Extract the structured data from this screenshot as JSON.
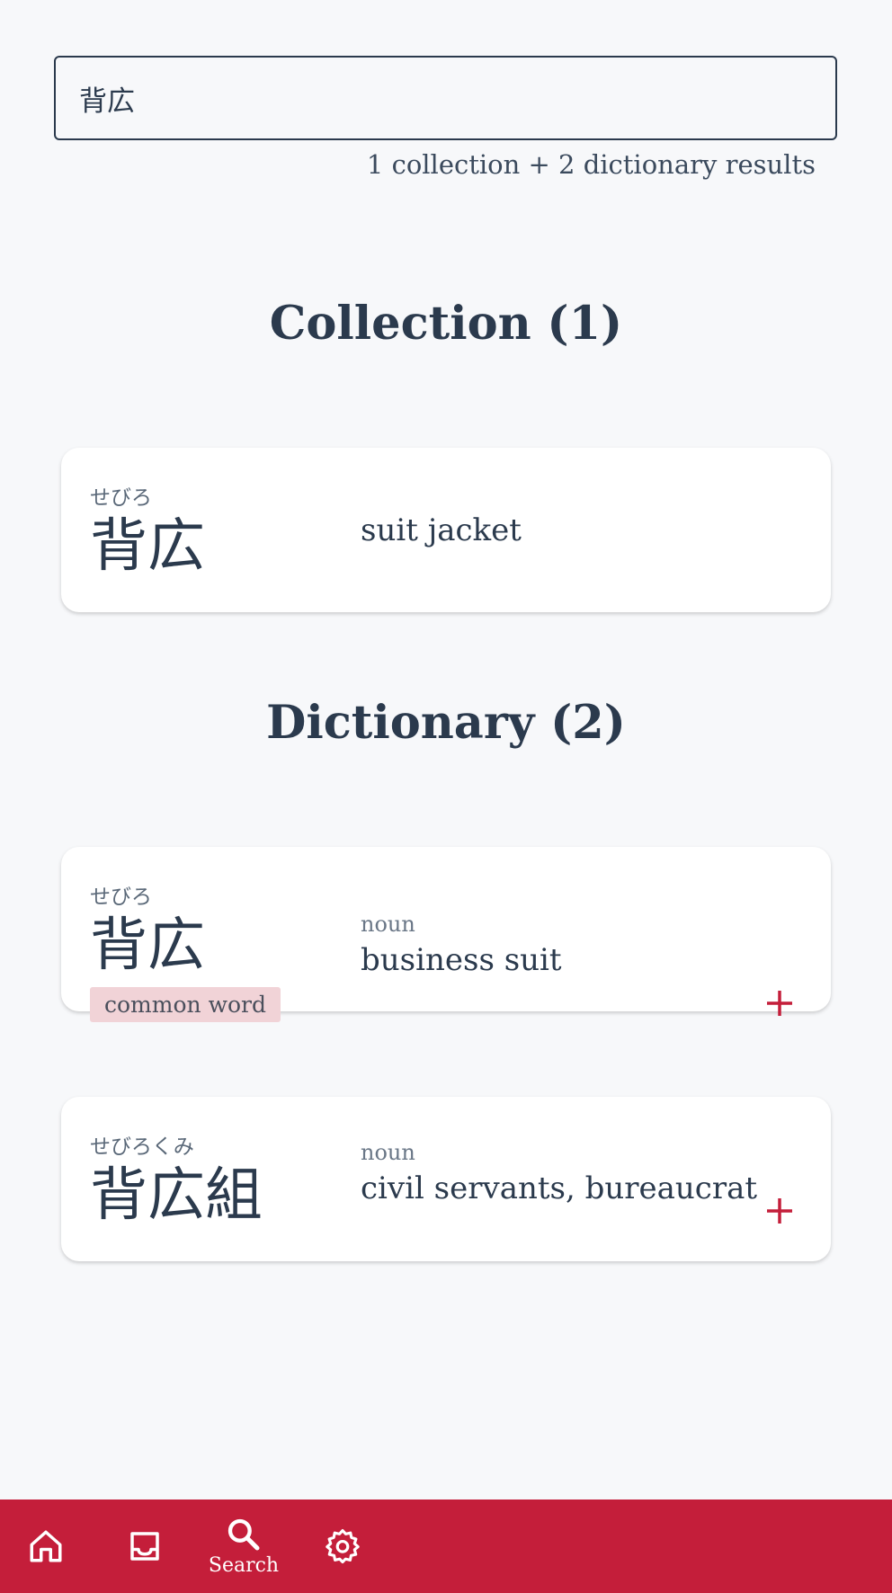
{
  "search": {
    "value": "背広",
    "result_count": "1 collection + 2 dictionary results"
  },
  "collection": {
    "title": "Collection (1)",
    "items": [
      {
        "reading": "せびろ",
        "word": "背広",
        "meaning": "suit jacket"
      }
    ]
  },
  "dictionary": {
    "title": "Dictionary (2)",
    "items": [
      {
        "reading": "せびろ",
        "word": "背広",
        "pos": "noun",
        "meaning": "business suit",
        "tag": "common word",
        "add_icon": "plus-icon"
      },
      {
        "reading": "せびろくみ",
        "word": "背広組",
        "pos": "noun",
        "meaning": "civil servants, bureaucrat",
        "add_icon": "plus-icon"
      }
    ]
  },
  "nav": {
    "items": [
      {
        "icon": "home-icon",
        "label": ""
      },
      {
        "icon": "inbox-icon",
        "label": ""
      },
      {
        "icon": "search-icon",
        "label": "Search",
        "active": true
      },
      {
        "icon": "gear-icon",
        "label": ""
      }
    ]
  },
  "colors": {
    "accent": "#c41e3a",
    "text": "#2b3a4d",
    "tag_bg": "#f1d3d7",
    "background": "#f7f8fa"
  }
}
